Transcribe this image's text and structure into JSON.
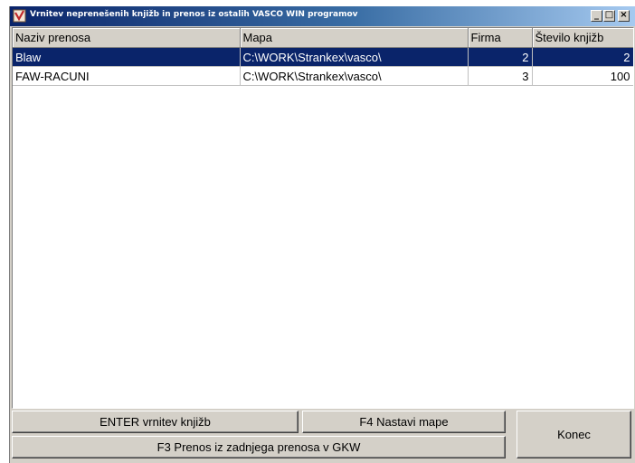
{
  "window": {
    "title": "Vrnitev neprenešenih knjižb in prenos iz ostalih VASCO WIN programov",
    "controls": {
      "minimize": "_",
      "maximize": "□",
      "close": "×"
    }
  },
  "grid": {
    "columns": [
      "Naziv prenosa",
      "Mapa",
      "Firma",
      "Število knjižb"
    ],
    "rows": [
      {
        "naziv": "Blaw",
        "mapa": "C:\\WORK\\Strankex\\vasco\\",
        "firma": "2",
        "stevilo": "2",
        "selected": true
      },
      {
        "naziv": "FAW-RACUNI",
        "mapa": "C:\\WORK\\Strankex\\vasco\\",
        "firma": "3",
        "stevilo": "100",
        "selected": false
      }
    ]
  },
  "buttons": {
    "enter": "ENTER vrnitev knjižb",
    "f4": "F4 Nastavi mape",
    "f3": "F3 Prenos iz zadnjega prenosa v GKW",
    "konec": "Konec"
  },
  "colors": {
    "title_start": "#0a246a",
    "selection": "#0a246a",
    "face": "#d4d0c8"
  }
}
